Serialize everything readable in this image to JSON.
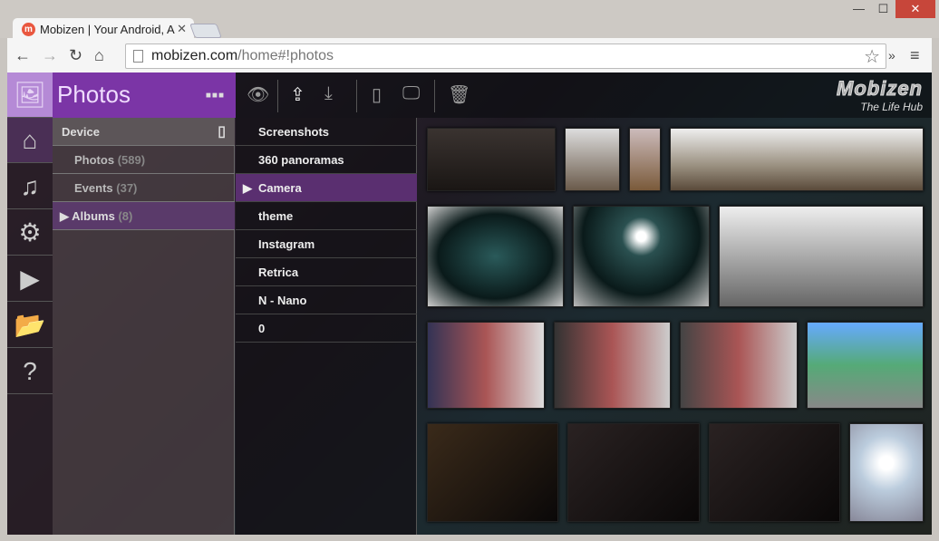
{
  "browser": {
    "tab_title": "Mobizen | Your Android, A",
    "url_host": "mobizen.com",
    "url_path": "/home#!photos",
    "favicon": "m",
    "more": "»",
    "menu": "≡"
  },
  "app": {
    "title": "Photos",
    "logo": "Mobizen",
    "tagline": "The Life Hub"
  },
  "nav": {
    "device": "Device",
    "items": [
      {
        "label": "Photos",
        "count": "(589)"
      },
      {
        "label": "Events",
        "count": "(37)"
      },
      {
        "label": "Albums",
        "count": "(8)"
      }
    ]
  },
  "albums": [
    "Screenshots",
    "360 panoramas",
    "Camera",
    "theme",
    "Instagram",
    "Retrica",
    "N - Nano",
    "0"
  ],
  "selected_album": "Camera",
  "sidebar_icons": [
    "photos-icon",
    "home-icon",
    "music-icon",
    "settings-icon",
    "play-icon",
    "folder-icon",
    "help-icon"
  ],
  "toolbar_icons": [
    "eye-icon",
    "upload-icon",
    "download-icon",
    "phone-icon",
    "monitor-icon",
    "trash-icon"
  ],
  "colors": {
    "accent": "#7b35a6",
    "selected": "#5a2f70"
  }
}
